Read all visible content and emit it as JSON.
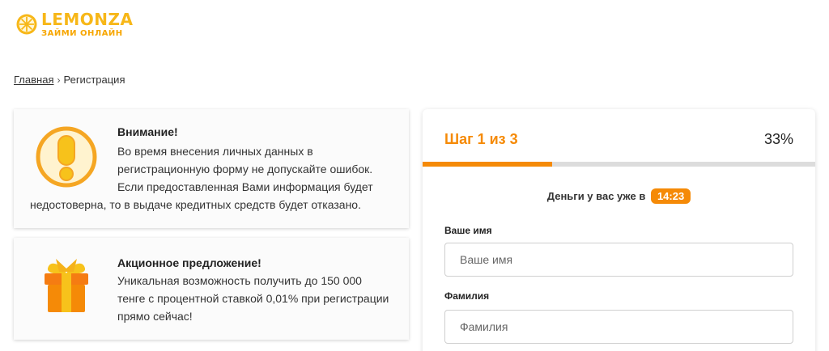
{
  "logo": {
    "title": "LEMONZA",
    "subtitle": "ЗАЙМИ ОНЛАЙН",
    "icon": "lemon-logo-icon",
    "brand_color": "#f7b718"
  },
  "breadcrumb": {
    "home": "Главная",
    "separator": "›",
    "current": "Регистрация"
  },
  "warning_card": {
    "icon": "exclamation-icon",
    "title": "Внимание!",
    "lines": [
      "Во время внесения личных данных в",
      "регистрационную форму не допускайте ошибок.",
      "Если предоставленная Вами информация будет",
      "недостоверна, то в выдаче кредитных средств будет отказано."
    ]
  },
  "promo_card": {
    "icon": "gift-icon",
    "title": "Акционное предложение!",
    "text": "Уникальная возможность получить до 150 000 тенге с процентной ставкой 0,01% при регистрации прямо сейчас!"
  },
  "form": {
    "step_label": "Шаг 1 из 3",
    "percent": "33%",
    "progress": 0.33,
    "timer_text": "Деньги у вас уже в",
    "timer_value": "14:23",
    "fields": [
      {
        "label": "Ваше имя",
        "placeholder": "Ваше имя",
        "value": ""
      },
      {
        "label": "Фамилия",
        "placeholder": "Фамилия",
        "value": ""
      }
    ],
    "accent_color": "#f58a07"
  }
}
